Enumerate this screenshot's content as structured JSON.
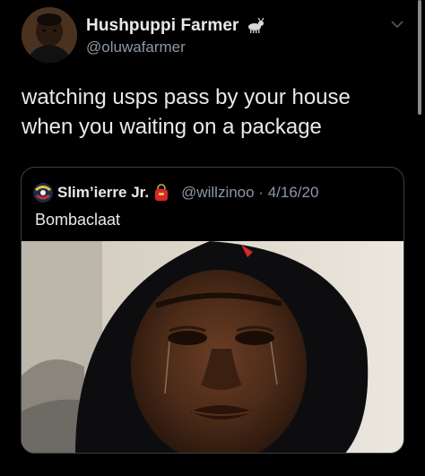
{
  "tweet": {
    "display_name": "Hushpuppi Farmer",
    "handle": "@oluwafarmer",
    "text": "watching usps pass by your house\nwhen you waiting on a package",
    "name_emoji_icon": "goat-icon",
    "menu_icon": "chevron-down-icon"
  },
  "quote": {
    "display_name": "Slim’ierre Jr.",
    "name_emoji_icon": "bag-icon",
    "handle_date": "@willzinoo · 4/16/20",
    "text": "Bombaclaat"
  },
  "colors": {
    "background": "#000000",
    "primary_text": "#e9e9e9",
    "secondary_text": "#8b98a5",
    "border": "#3a3f44"
  }
}
